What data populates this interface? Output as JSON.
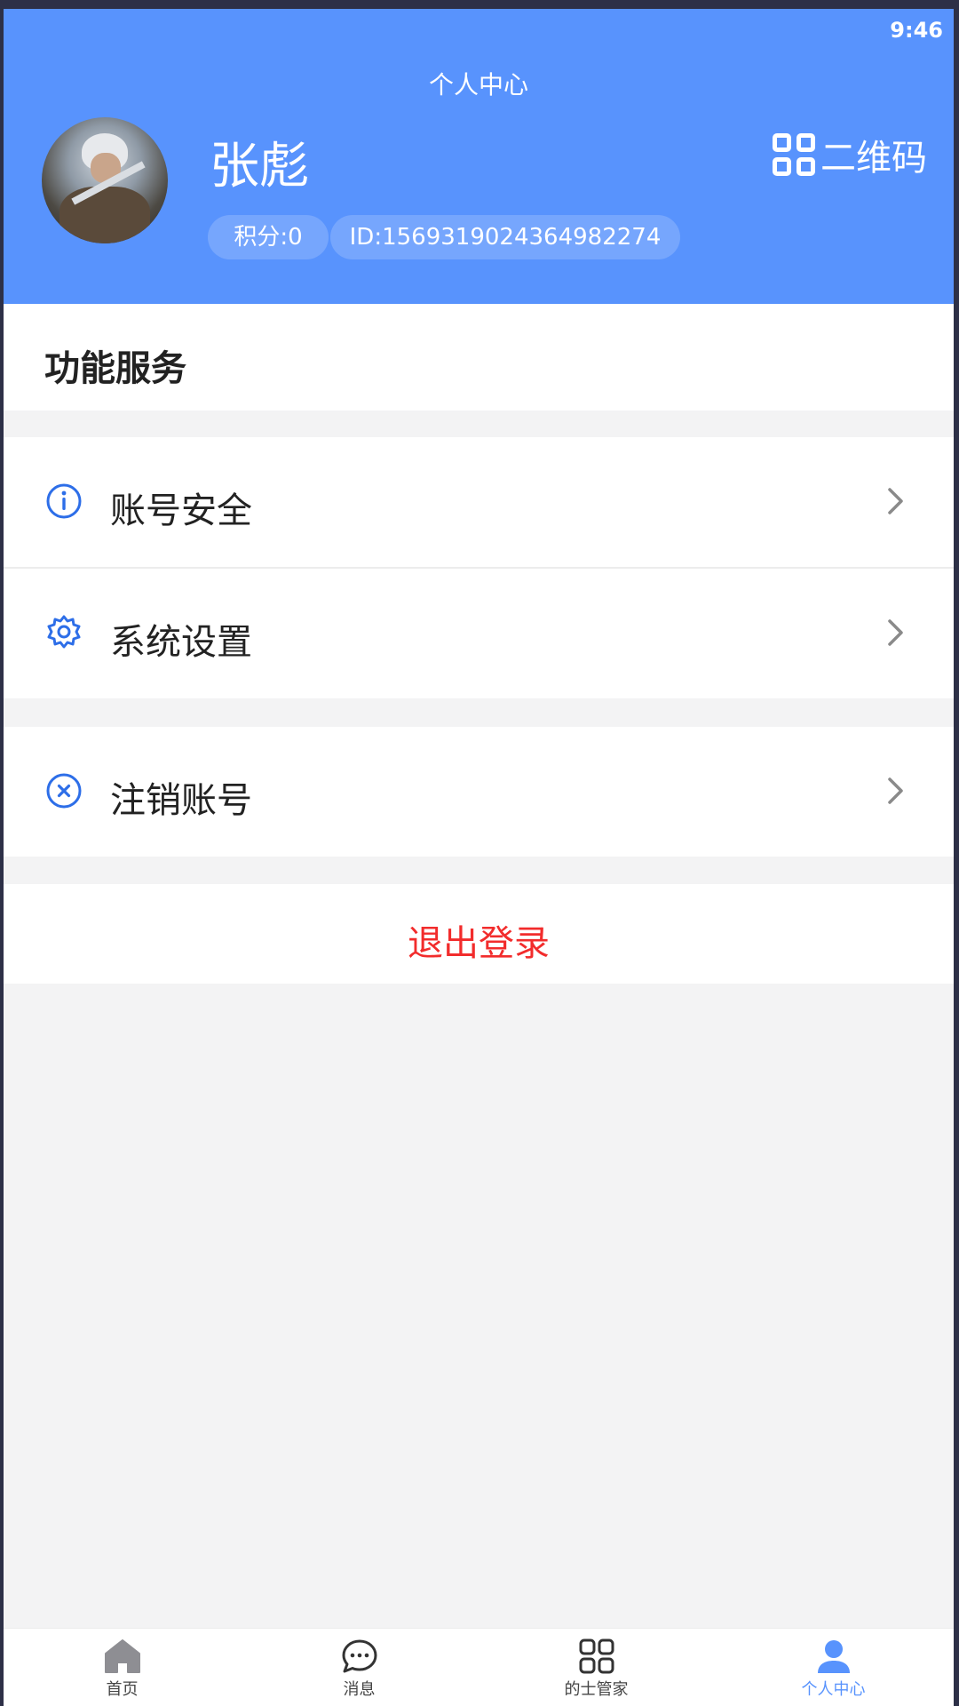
{
  "status_bar": {
    "time": "9:46"
  },
  "header": {
    "title": "个人中心",
    "user_name": "张彪",
    "points": "积分:0",
    "user_id": "ID:1569319024364982274",
    "qr_label": "二维码"
  },
  "section": {
    "title": "功能服务"
  },
  "menu": [
    {
      "label": "账号安全",
      "icon": "info-icon"
    },
    {
      "label": "系统设置",
      "icon": "gear-icon"
    },
    {
      "label": "注销账号",
      "icon": "close-circle-icon"
    }
  ],
  "logout": {
    "label": "退出登录"
  },
  "tabbar": [
    {
      "label": "首页",
      "icon": "home-icon",
      "active": false
    },
    {
      "label": "消息",
      "icon": "message-icon",
      "active": false
    },
    {
      "label": "的士管家",
      "icon": "grid-icon",
      "active": false
    },
    {
      "label": "个人中心",
      "icon": "user-icon",
      "active": true
    }
  ],
  "colors": {
    "header_bg": "#5893fd",
    "accent": "#5893fd",
    "icon_blue": "#2d6ee8",
    "logout_red": "#f22c2c",
    "page_bg": "#f3f3f4"
  }
}
